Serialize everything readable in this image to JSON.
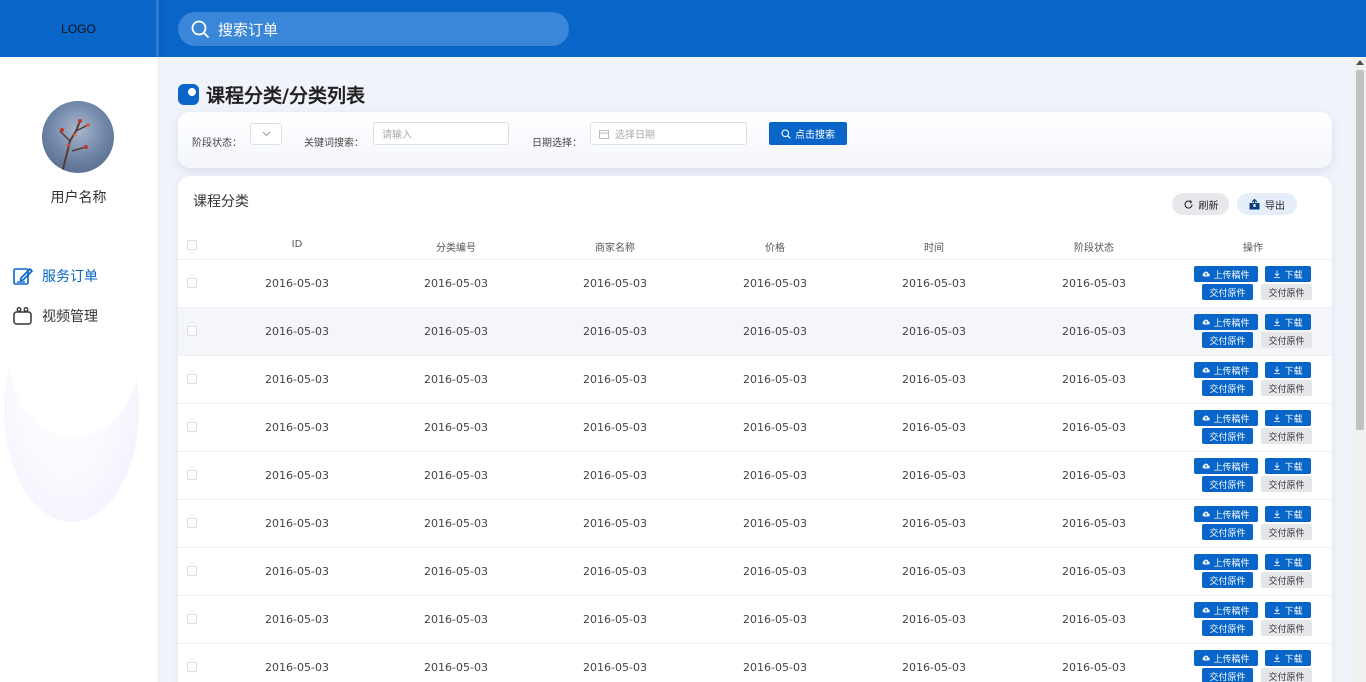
{
  "header": {
    "logo": "LOGO",
    "search_placeholder": "搜索订单"
  },
  "sidebar": {
    "username": "用户名称",
    "nav": [
      {
        "label": "服务订单",
        "icon": "edit-icon",
        "active": true
      },
      {
        "label": "视频管理",
        "icon": "video-icon",
        "active": false
      }
    ]
  },
  "page": {
    "title": "课程分类/分类列表"
  },
  "filters": {
    "stage_label": "阶段状态：",
    "keyword_label": "关键词搜索：",
    "keyword_placeholder": "请输入",
    "date_label": "日期选择：",
    "date_placeholder": "选择日期",
    "search_button": "点击搜索"
  },
  "table": {
    "title": "课程分类",
    "refresh_label": "刷新",
    "export_label": "导出",
    "columns": [
      "ID",
      "分类编号",
      "商家名称",
      "价格",
      "时间",
      "阶段状态",
      "操作"
    ],
    "rows": [
      [
        "2016-05-03",
        "2016-05-03",
        "2016-05-03",
        "2016-05-03",
        "2016-05-03",
        "2016-05-03"
      ],
      [
        "2016-05-03",
        "2016-05-03",
        "2016-05-03",
        "2016-05-03",
        "2016-05-03",
        "2016-05-03"
      ],
      [
        "2016-05-03",
        "2016-05-03",
        "2016-05-03",
        "2016-05-03",
        "2016-05-03",
        "2016-05-03"
      ],
      [
        "2016-05-03",
        "2016-05-03",
        "2016-05-03",
        "2016-05-03",
        "2016-05-03",
        "2016-05-03"
      ],
      [
        "2016-05-03",
        "2016-05-03",
        "2016-05-03",
        "2016-05-03",
        "2016-05-03",
        "2016-05-03"
      ],
      [
        "2016-05-03",
        "2016-05-03",
        "2016-05-03",
        "2016-05-03",
        "2016-05-03",
        "2016-05-03"
      ],
      [
        "2016-05-03",
        "2016-05-03",
        "2016-05-03",
        "2016-05-03",
        "2016-05-03",
        "2016-05-03"
      ],
      [
        "2016-05-03",
        "2016-05-03",
        "2016-05-03",
        "2016-05-03",
        "2016-05-03",
        "2016-05-03"
      ],
      [
        "2016-05-03",
        "2016-05-03",
        "2016-05-03",
        "2016-05-03",
        "2016-05-03",
        "2016-05-03"
      ]
    ],
    "actions": {
      "upload": "上传稿件",
      "download": "下载",
      "deliver": "交付原件",
      "deliver_alt": "交付原件"
    }
  },
  "colors": {
    "primary": "#0a65c8",
    "background": "#f0f3f9",
    "row_alt": "#f4f6fa"
  }
}
